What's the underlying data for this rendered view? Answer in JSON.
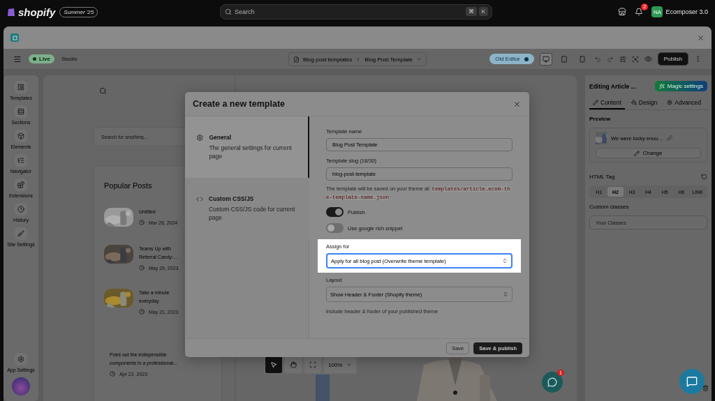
{
  "shopify_bar": {
    "logo": "shopify",
    "badge": "Summer '25",
    "search": {
      "placeholder": "Search"
    },
    "shortcut_keys": [
      "⌘",
      "K"
    ],
    "notification_count": "2",
    "avatar_initials": "NA",
    "store_name": "Ecomposer 3.0"
  },
  "app_toolbar": {
    "status": "Live",
    "mode": "Studio",
    "breadcrumb": [
      "Blog post templates",
      "Blog Post Template"
    ],
    "old_editor": {
      "label": "Old Editor",
      "on": false
    },
    "devices": [
      {
        "selected": true
      },
      {
        "selected": false
      },
      {
        "selected": false
      }
    ],
    "publish": "Publish"
  },
  "sidebar": {
    "items": [
      {
        "label": "Templates"
      },
      {
        "label": "Sections"
      },
      {
        "label": "Elements"
      },
      {
        "label": "Navigator"
      },
      {
        "label": "Extensions"
      },
      {
        "label": "History"
      },
      {
        "label": "Site Settings"
      }
    ],
    "bottom_item": {
      "label": "App Settings"
    }
  },
  "preview_page": {
    "search": {
      "placeholder": "Search for anything..."
    },
    "popular_posts": {
      "title": "Popular Posts",
      "posts": [
        {
          "title": "Untitled",
          "date": "Mar 28, 2024",
          "has_picture": true
        },
        {
          "title": "Teams Up with Referral Candy:...",
          "date": "May 29, 2023",
          "has_picture": true
        },
        {
          "title": "Take a minute everyday",
          "date": "May 21, 2023",
          "has_picture": true
        },
        {
          "title": "Point out the indispensible components in a professional...",
          "date": "Apr 22, 2023",
          "has_picture": false
        }
      ]
    }
  },
  "canvas_toolbar": {
    "tools": [
      {
        "selected": true
      },
      {
        "selected": false
      },
      {
        "selected": false
      }
    ],
    "zoom": "100%"
  },
  "chat": {
    "badge": "1"
  },
  "modal": {
    "title": "Create a new template",
    "nav": [
      {
        "title": "General",
        "description": "The general settings for current page",
        "selected": true
      },
      {
        "title": "Custom CSS/JS",
        "description": "Custom CSS/JS code for current page",
        "selected": false
      }
    ],
    "fields": {
      "name": {
        "label": "Template name",
        "value": "Blog Post Template"
      },
      "slug": {
        "label": "Template slug (18/30)",
        "value": "blog-post-template"
      },
      "save_note": {
        "text": "The template will be saved on your theme at:",
        "path": "templates/article.ecom-the-template-name.json"
      },
      "toggles": [
        {
          "label": "Publish",
          "on": true
        },
        {
          "label": "Use google rich snippet",
          "on": false
        }
      ],
      "assign": {
        "label": "Assign for",
        "value": "Apply for all blog post (Overwrite theme template)",
        "highlighted": true
      },
      "layout": {
        "label": "Layout",
        "value": "Show Header & Footer (Shopify theme)",
        "help": "Include header & footer of your published theme"
      }
    },
    "buttons": {
      "save": "Save",
      "save_publish": "Save & publish"
    }
  },
  "right_panel": {
    "title": "Editing Article ...",
    "magic": "Magic settings",
    "tabs": [
      {
        "label": "Content",
        "selected": true
      },
      {
        "label": "Design",
        "selected": false
      },
      {
        "label": "Advanced",
        "selected": false
      }
    ],
    "preview": {
      "label": "Preview",
      "text": "We were lucky enou...",
      "change": "Change"
    },
    "html_tag": {
      "label": "HTML Tag",
      "options": [
        {
          "label": "H1",
          "selected": false
        },
        {
          "label": "H2",
          "selected": true
        },
        {
          "label": "H3",
          "selected": false
        },
        {
          "label": "H4",
          "selected": false
        },
        {
          "label": "H5",
          "selected": false
        },
        {
          "label": "H6",
          "selected": false
        },
        {
          "label": "LINK",
          "selected": false
        }
      ]
    },
    "custom_classes": {
      "label": "Custom classes",
      "placeholder": "Your Classes"
    }
  }
}
